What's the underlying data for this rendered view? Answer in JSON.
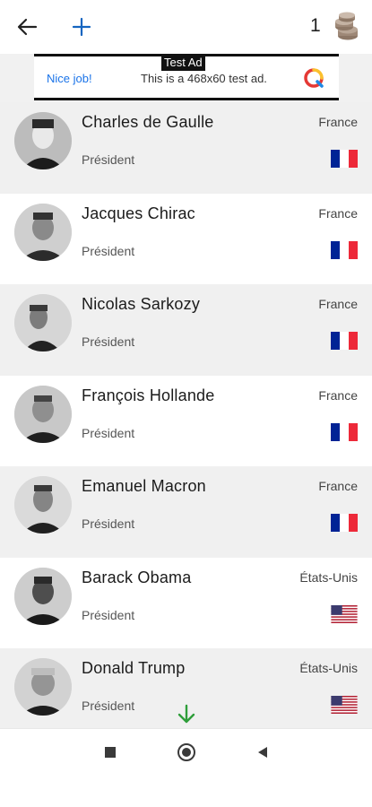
{
  "topbar": {
    "coin_count": "1"
  },
  "ad": {
    "tag": "Test Ad",
    "nice": "Nice job!",
    "text": "This is a 468x60 test ad."
  },
  "leaders": [
    {
      "name": "Charles de Gaulle",
      "role": "Président",
      "country": "France",
      "flag": "france"
    },
    {
      "name": "Jacques Chirac",
      "role": "Président",
      "country": "France",
      "flag": "france"
    },
    {
      "name": "Nicolas Sarkozy",
      "role": "Président",
      "country": "France",
      "flag": "france"
    },
    {
      "name": "François Hollande",
      "role": "Président",
      "country": "France",
      "flag": "france"
    },
    {
      "name": "Emanuel Macron",
      "role": "Président",
      "country": "France",
      "flag": "france"
    },
    {
      "name": "Barack Obama",
      "role": "Président",
      "country": "États-Unis",
      "flag": "usa"
    },
    {
      "name": "Donald Trump",
      "role": "Président",
      "country": "États-Unis",
      "flag": "usa"
    }
  ],
  "colors": {
    "row_shaded": "#f0f0f0",
    "row_white": "#ffffff",
    "france_blue": "#002395",
    "france_red": "#ED2939",
    "usa_red": "#B22234",
    "usa_blue": "#3C3B6E",
    "accent_blue": "#1a73e8",
    "scroll_arrow_green": "#2e9e3a"
  }
}
